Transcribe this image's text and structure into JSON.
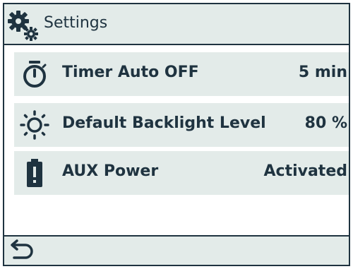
{
  "header": {
    "title": "Settings",
    "icon": "settings-gears-icon"
  },
  "settings": [
    {
      "icon": "stopwatch-icon",
      "label": "Timer Auto OFF",
      "value": "5 min"
    },
    {
      "icon": "sun-icon",
      "label": "Default Backlight Level",
      "value": "80 %"
    },
    {
      "icon": "battery-alert-icon",
      "label": "AUX Power",
      "value": "Activated"
    }
  ],
  "footer": {
    "icon": "back-arrow-icon"
  },
  "colors": {
    "ink": "#1f3340",
    "panel": "#e3ebe9",
    "background": "#ffffff"
  }
}
